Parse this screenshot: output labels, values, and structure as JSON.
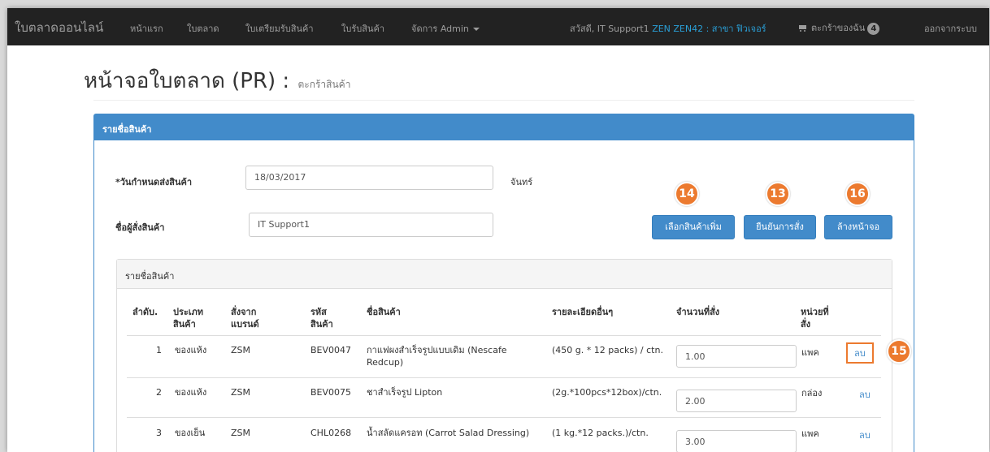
{
  "navbar": {
    "brand": "ใบตลาดออนไลน์",
    "items": [
      "หน้าแรก",
      "ใบตลาด",
      "ใบเตรียมรับสินค้า",
      "ใบรับสินค้า",
      "จัดการ Admin"
    ],
    "greeting": "สวัสดี, IT Support1",
    "branch": "ZEN ZEN42 : สาขา ฟิวเจอร์",
    "cart_label": "ตะกร้าของฉัน",
    "cart_count": "4",
    "logout": "ออกจากระบบ"
  },
  "page": {
    "title": "หน้าจอใบตลาด (PR) :",
    "subtitle": "ตะกร้าสินค้า"
  },
  "panel": {
    "heading": "รายชื่อสินค้า",
    "delivery_date_label": "*วันกำหนดส่งสินค้า",
    "delivery_date_value": "18/03/2017",
    "delivery_day": "จันทร์",
    "orderer_label": "ชื่อผู้สั่งสินค้า",
    "orderer_value": "IT Support1",
    "buttons": {
      "add_more": "เลือกสินค้าเพิ่ม",
      "confirm": "ยืนยันการสั่ง",
      "clear": "ล้างหน้าจอ"
    },
    "step_badges": {
      "add_more": "14",
      "confirm": "13",
      "clear": "16",
      "delete": "15"
    }
  },
  "list": {
    "heading": "รายชื่อสินค้า",
    "columns": [
      "ลำดับ.",
      "ประเภท สินค้า",
      "สั่งจาก แบรนด์",
      "รหัส สินค้า",
      "ชื่อสินค้า",
      "รายละเอียดอื่นๆ",
      "จำนวนที่สั่ง",
      "หน่วยที่ สั่ง"
    ],
    "rows": [
      {
        "no": "1",
        "type": "ของแห้ง",
        "brand": "ZSM",
        "code": "BEV0047",
        "name": "กาแฟผงสำเร็จรูปแบบเดิม (Nescafe Redcup)",
        "detail": "(450 g. * 12 packs) / ctn.",
        "qty": "1.00",
        "unit": "แพค",
        "action": "ลบ"
      },
      {
        "no": "2",
        "type": "ของแห้ง",
        "brand": "ZSM",
        "code": "BEV0075",
        "name": "ชาสำเร็จรูป Lipton",
        "detail": "(2g.*100pcs*12box)/ctn.",
        "qty": "2.00",
        "unit": "กล่อง",
        "action": "ลบ"
      },
      {
        "no": "3",
        "type": "ของเย็น",
        "brand": "ZSM",
        "code": "CHL0268",
        "name": "น้ำสลัดแครอท (Carrot Salad Dressing)",
        "detail": "(1 kg.*12 packs.)/ctn.",
        "qty": "3.00",
        "unit": "แพค",
        "action": "ลบ"
      }
    ]
  },
  "colors": {
    "navbar": "#222222",
    "primary": "#428bca",
    "highlight": "#ec7a2f",
    "link": "#2a9fd6"
  }
}
